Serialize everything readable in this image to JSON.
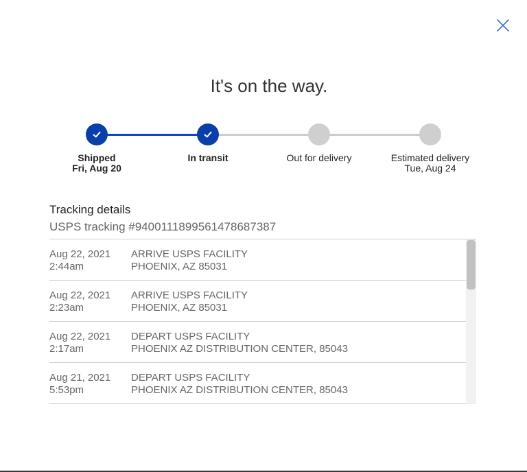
{
  "dialog": {
    "title": "It's on the way.",
    "close_icon": "close-icon"
  },
  "progress": {
    "steps": [
      {
        "name": "Shipped",
        "date": "Fri, Aug 20",
        "done": true
      },
      {
        "name": "In transit",
        "date": "",
        "done": true
      },
      {
        "name": "Out for delivery",
        "date": "",
        "done": false
      },
      {
        "name": "Estimated delivery",
        "date": "Tue, Aug 24",
        "done": false
      }
    ],
    "colors": {
      "done": "#0a3ea8",
      "pending": "#cfcfcf",
      "line_done": "#0a46c7",
      "line_pending": "#cccccc"
    }
  },
  "tracking": {
    "heading": "Tracking details",
    "number_label": "USPS tracking #9400111899561478687387",
    "events": [
      {
        "date": "Aug 22, 2021",
        "time": "2:44am",
        "status": "ARRIVE USPS FACILITY",
        "location": "PHOENIX, AZ 85031"
      },
      {
        "date": "Aug 22, 2021",
        "time": "2:23am",
        "status": "ARRIVE USPS FACILITY",
        "location": "PHOENIX, AZ 85031"
      },
      {
        "date": "Aug 22, 2021",
        "time": "2:17am",
        "status": "DEPART USPS FACILITY",
        "location": "PHOENIX AZ DISTRIBUTION CENTER, 85043"
      },
      {
        "date": "Aug 21, 2021",
        "time": "5:53pm",
        "status": "DEPART USPS FACILITY",
        "location": "PHOENIX AZ DISTRIBUTION CENTER, 85043"
      }
    ]
  },
  "icons": {
    "check": "check-icon",
    "close": "close-icon"
  },
  "accent_color": "#3d6fd9"
}
